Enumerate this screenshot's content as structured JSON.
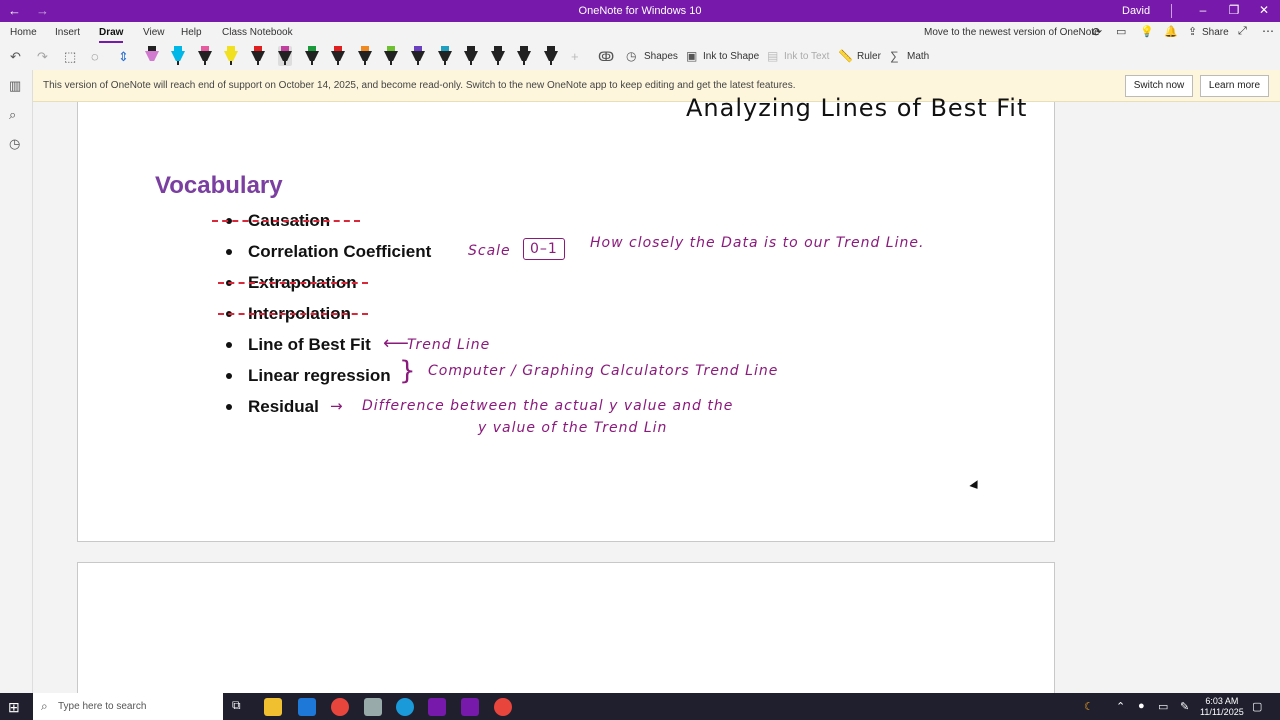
{
  "titlebar": {
    "title": "OneNote for Windows 10",
    "user": "David"
  },
  "menu": {
    "tabs": [
      "Home",
      "Insert",
      "Draw",
      "View",
      "Help",
      "Class Notebook"
    ],
    "newest": "Move to the newest version of OneNote",
    "share": "Share"
  },
  "toolbar": {
    "shapes": "Shapes",
    "ink_to_shape": "Ink to Shape",
    "ink_to_text": "Ink to Text",
    "ruler": "Ruler",
    "math": "Math"
  },
  "banner": {
    "message": "This version of OneNote will reach end of support on October 14, 2025, and become read-only. Switch to the new OneNote app to keep editing and get the latest features.",
    "switch_now": "Switch now",
    "learn_more": "Learn more"
  },
  "page": {
    "title": "Analyzing Lines of Best Fit",
    "vocab_heading": "Vocabulary",
    "terms": [
      "Causation",
      "Correlation Coefficient",
      "Extrapolation",
      "Interpolation",
      "Line of Best Fit",
      "Linear regression",
      "Residual"
    ],
    "ink": {
      "scale": "Scale",
      "range": "0–1",
      "how_closely": "How closely the Data is to our Trend Line.",
      "trend_line": "Trend Line",
      "computer": "Computer / Graphing Calculators Trend Line",
      "residual_1": "Difference between the actual y value and the",
      "residual_2": "y value of the Trend Lin"
    }
  },
  "taskbar": {
    "search_placeholder": "Type here to search",
    "time": "6:03 AM",
    "date": "11/11/2025"
  },
  "colors": {
    "accent": "#7719aa",
    "ink": "#8a1a7c",
    "strike": "#d8283a",
    "vocab": "#7a3fa0"
  }
}
